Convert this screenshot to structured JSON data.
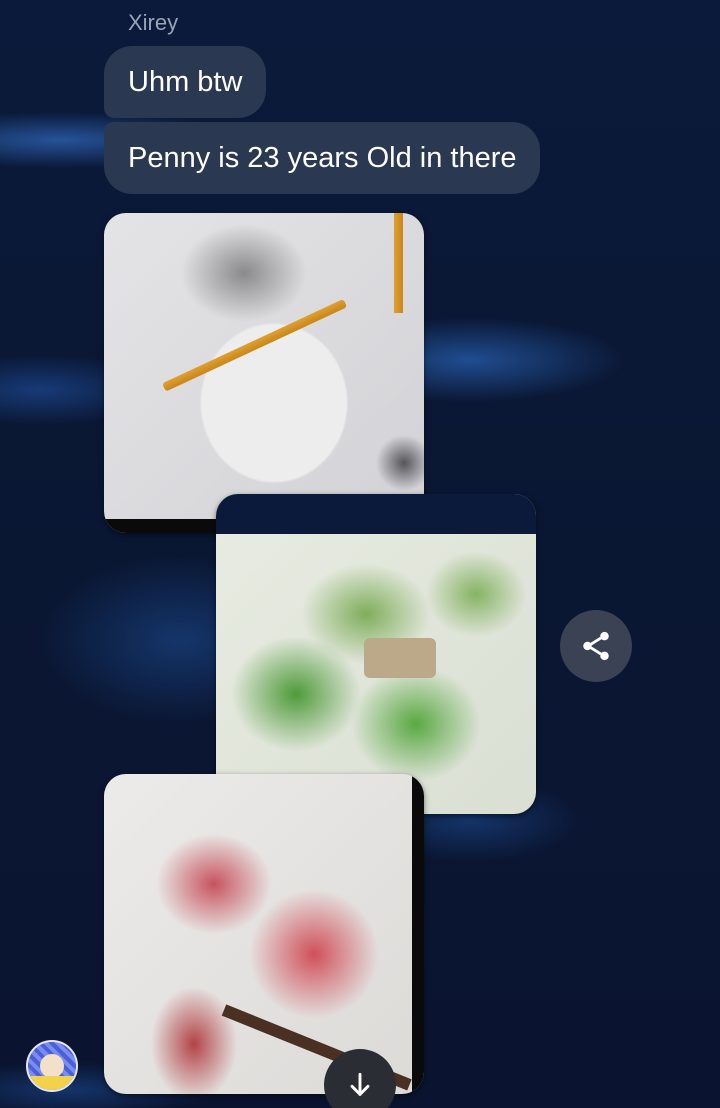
{
  "chat": {
    "sender_name": "Xirey",
    "messages": [
      {
        "text": "Uhm btw"
      },
      {
        "text": "Penny is 23 years Old in there"
      }
    ],
    "attachments": [
      {
        "kind": "image",
        "description_icon": "pencil-sketch-photo"
      },
      {
        "kind": "image",
        "description_icon": "green-drawing-photo"
      },
      {
        "kind": "image",
        "description_icon": "red-drawing-photo"
      }
    ]
  },
  "actions": {
    "share_icon": "share-icon",
    "scroll_down_icon": "arrow-down-icon"
  },
  "colors": {
    "background": "#0b1a3a",
    "bubble": "#2b3852",
    "bubble_text": "#ffffff",
    "sender_text": "#9aa3b5"
  }
}
